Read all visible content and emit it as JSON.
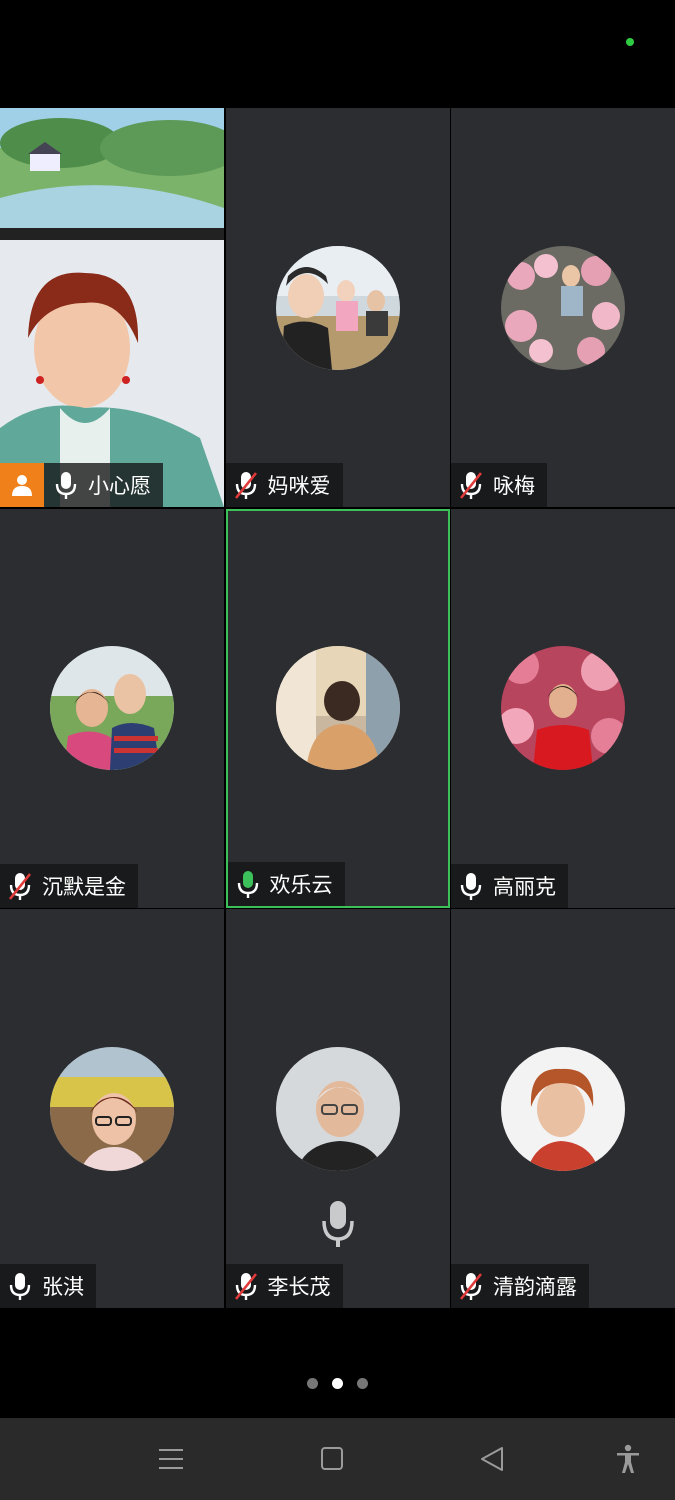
{
  "status": {
    "indicator_color": "#2ecc40"
  },
  "participants": [
    {
      "name": "小心愿",
      "mic": "on",
      "host": true,
      "video": true
    },
    {
      "name": "妈咪爱",
      "mic": "muted"
    },
    {
      "name": "咏梅",
      "mic": "muted"
    },
    {
      "name": "沉默是金",
      "mic": "muted"
    },
    {
      "name": "欢乐云",
      "mic": "speaking",
      "active": true
    },
    {
      "name": "高丽克",
      "mic": "on"
    },
    {
      "name": "张淇",
      "mic": "on"
    },
    {
      "name": "李长茂",
      "mic": "muted"
    },
    {
      "name": "清韵滴露",
      "mic": "muted"
    }
  ],
  "pagination": {
    "pages": 3,
    "current": 2
  },
  "navbar": {
    "icons": [
      "menu-icon",
      "home-square-icon",
      "back-triangle-icon",
      "accessibility-icon"
    ]
  },
  "colors": {
    "tile_bg": "#2b2d31",
    "active_border": "#3cc15a",
    "host_badge": "#f0801a",
    "speaking_mic": "#3cc15a",
    "muted_slash": "#e03a3a"
  }
}
